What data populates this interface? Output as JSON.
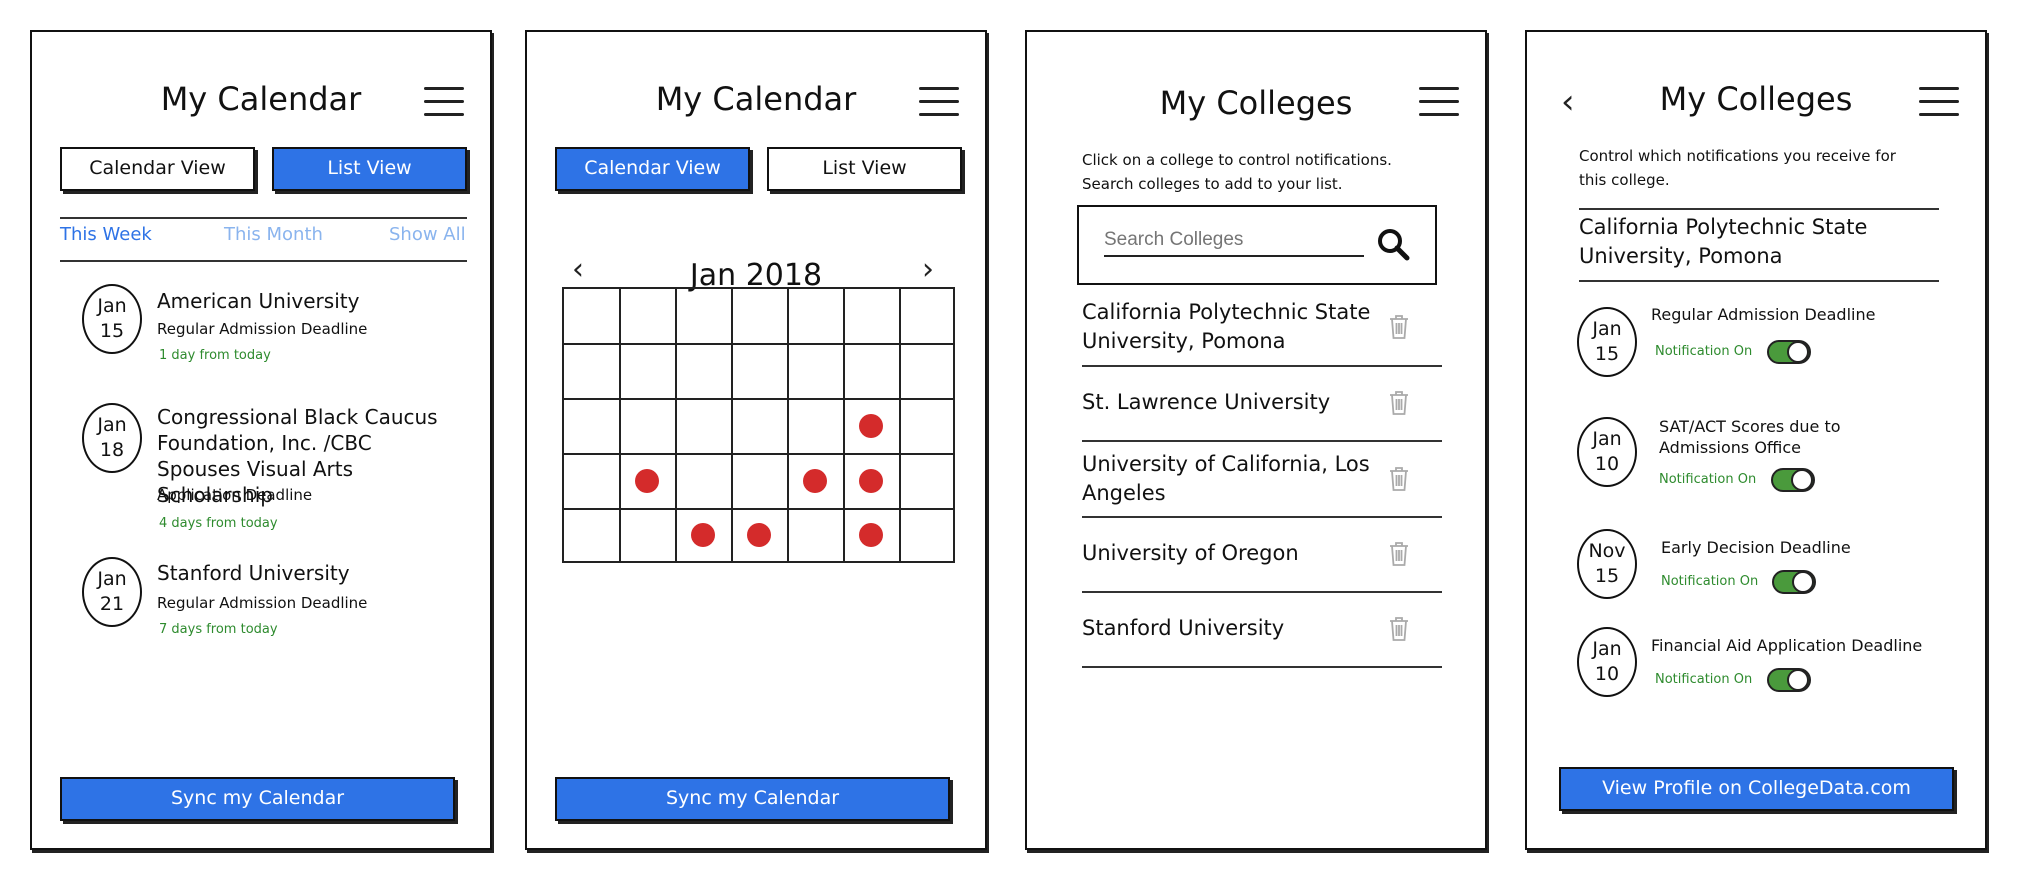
{
  "menu_icon": "hamburger-icon",
  "screen1": {
    "title": "My Calendar",
    "btn_calendar": "Calendar View",
    "btn_list": "List View",
    "filters": [
      "This Week",
      "This Month",
      "Show All"
    ],
    "events": [
      {
        "month": "Jan",
        "day": "15",
        "title": "American University",
        "subtitle": "Regular Admission Deadline",
        "relative": "1 day from today"
      },
      {
        "month": "Jan",
        "day": "18",
        "title": "Congressional Black Caucus Foundation, Inc. /CBC Spouses Visual Arts Scholarship",
        "subtitle": "Application Deadline",
        "relative": "4 days from today"
      },
      {
        "month": "Jan",
        "day": "21",
        "title": "Stanford University",
        "subtitle": "Regular Admission Deadline",
        "relative": "7 days from today"
      }
    ],
    "sync": "Sync my Calendar"
  },
  "screen2": {
    "title": "My Calendar",
    "btn_calendar": "Calendar View",
    "btn_list": "List View",
    "month": "Jan 2018",
    "prev": "‹",
    "next": "›",
    "sync": "Sync my Calendar"
  },
  "screen3": {
    "title": "My Colleges",
    "note1": "Click on a college to control notifications.",
    "note2": "Search colleges to add to your list.",
    "search_placeholder": "Search Colleges",
    "colleges": [
      "California Polytechnic State University, Pomona",
      "St. Lawrence University",
      "University of California, Los Angeles",
      "University of Oregon",
      "Stanford University"
    ]
  },
  "screen4": {
    "back": "‹",
    "title": "My Colleges",
    "note": "Control which notifications you receive for this college.",
    "college": "California Polytechnic State University, Pomona",
    "deadlines": [
      {
        "month": "Jan",
        "day": "15",
        "title": "Regular Admission Deadline",
        "status": "Notification On"
      },
      {
        "month": "Jan",
        "day": "10",
        "title": "SAT/ACT Scores due to Admissions Office",
        "status": "Notification On"
      },
      {
        "month": "Nov",
        "day": "15",
        "title": "Early Decision Deadline",
        "status": "Notification On"
      },
      {
        "month": "Jan",
        "day": "10",
        "title": "Financial Aid Application Deadline",
        "status": "Notification On"
      }
    ],
    "profile_btn": "View Profile on CollegeData.com"
  },
  "colors": {
    "blue": "#2e73e6",
    "red_dot": "#d42b2b",
    "green_text": "#2e8b2e",
    "toggle_green": "#4a9a3c",
    "muted_link": "#8ab4ee"
  }
}
